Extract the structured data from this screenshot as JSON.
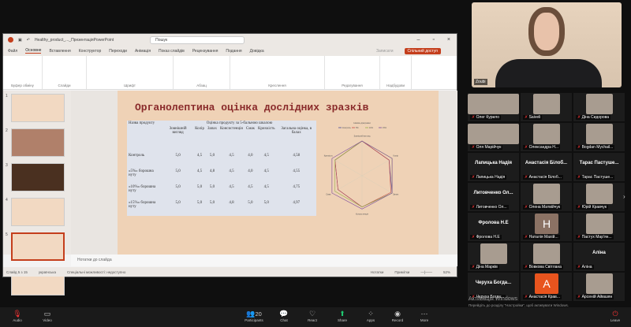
{
  "ppt": {
    "title": "Healthy_product_..._ПрезентаціяPowerPoint",
    "search": "Пошук",
    "tabs": [
      "Файл",
      "Основне",
      "Вставлення",
      "Конструктор",
      "Переходи",
      "Анімація",
      "Показ слайдів",
      "Рецензування",
      "Подання",
      "Довідка"
    ],
    "share": "Спільний доступ",
    "record": "Записати",
    "groups": [
      "Буфер обміну",
      "Слайди",
      "Шрифт",
      "Абзац",
      "Креслення",
      "Редагування",
      "Надбудови"
    ],
    "notes": "Нотатки до слайда",
    "status": {
      "slide": "Слайд 5 з 15",
      "lang": "українська",
      "access": "Спеціальні можливості: недоступно",
      "notes": "Нотатки",
      "comments": "Примітки",
      "zoom": "52%"
    },
    "thumb_numbers": [
      "1",
      "2",
      "3",
      "4",
      "5",
      "6"
    ]
  },
  "slide": {
    "title": "Органолептина оцінка дослідних зразків",
    "table": {
      "corner": "Назва продукту",
      "group": "Оцінка продукту за 5-бальною шкалою",
      "headers": [
        "Зовнішній вигляд",
        "Колір",
        "Запах",
        "Консистенція",
        "Смак",
        "Крихкість",
        "Загальна оцінка, в балах"
      ],
      "rows": [
        [
          "Контроль",
          "5,0",
          "4,5",
          "5,0",
          "4,5",
          "4,0",
          "4,5",
          "4,58"
        ],
        [
          "«5%» борошна нуту",
          "5,0",
          "4,5",
          "4,8",
          "4,5",
          "4,0",
          "4,5",
          "4,55"
        ],
        [
          "«10%» борошна нуту",
          "5,0",
          "5,0",
          "5,0",
          "4,5",
          "4,5",
          "4,5",
          "4,75"
        ],
        [
          "«15%» борошна нуту",
          "5,0",
          "5,0",
          "5,0",
          "4,8",
          "5,0",
          "5,0",
          "4,97"
        ]
      ]
    }
  },
  "chart_data": {
    "type": "radar",
    "title": "Назва діаграми",
    "categories": [
      "Зовнішній вигляд",
      "Колір",
      "Запах",
      "Консистенція",
      "Смак",
      "Крихкість"
    ],
    "range": [
      0,
      5
    ],
    "series": [
      {
        "name": "Контроль",
        "color": "#4a4a9a",
        "values": [
          5,
          4.5,
          5,
          4.5,
          4,
          4.5
        ]
      },
      {
        "name": "5%",
        "color": "#c24a4a",
        "values": [
          5,
          4.5,
          4.8,
          4.5,
          4,
          4.5
        ]
      },
      {
        "name": "10%",
        "color": "#9ab04a",
        "values": [
          5,
          5,
          5,
          4.5,
          4.5,
          4.5
        ]
      },
      {
        "name": "15%",
        "color": "#7a4a9a",
        "values": [
          5,
          5,
          5,
          4.8,
          5,
          5
        ]
      }
    ]
  },
  "speaker": {
    "name": "Zoubi"
  },
  "participants": [
    {
      "name": "Олег Курило",
      "t": "p"
    },
    {
      "name": "Saiveli",
      "t": "p"
    },
    {
      "name": "Діна Сидорова",
      "t": "p"
    },
    {
      "name": "Оля Марійчук",
      "t": "p"
    },
    {
      "name": "Олександра Н...",
      "t": "p"
    },
    {
      "name": "Bogdan Mychail...",
      "t": "p"
    },
    {
      "name": "Лапицька Надія",
      "big": "Лапицька Надія",
      "t": "n"
    },
    {
      "name": "Анастасія Білоб...",
      "big": "Анастасія Білоб...",
      "t": "n"
    },
    {
      "name": "Тарас Пастуше...",
      "big": "Тарас Пастуше...",
      "t": "n"
    },
    {
      "name": "Литовченко Ол...",
      "big": "Литовченко Ол...",
      "t": "n"
    },
    {
      "name": "Олена Матвійчук",
      "t": "p"
    },
    {
      "name": "Юрій Кравчук",
      "t": "p"
    },
    {
      "name": "Фролова Н.Е",
      "big": "Фролова Н.Е",
      "t": "n"
    },
    {
      "name": "Наталія Махій...",
      "t": "a",
      "letter": "H",
      "color": "#8b7264"
    },
    {
      "name": "Пастух Мар'ян...",
      "t": "p"
    },
    {
      "name": "Діна Марків",
      "t": "p"
    },
    {
      "name": "Вовкова Світлана",
      "t": "p"
    },
    {
      "name": "Аліна",
      "big": "Аліна",
      "t": "n"
    },
    {
      "name": "Черуха Богда...",
      "big": "Черуха Богда...",
      "t": "n"
    },
    {
      "name": "Анастасія Крав...",
      "t": "a",
      "letter": "A",
      "color": "#e8541e"
    },
    {
      "name": "Арсеній Айвазян",
      "t": "p"
    }
  ],
  "watermark": {
    "title": "Активація Windows",
    "text": "Перейдіть до розділу \"Настройки\", щоб активувати Windows."
  },
  "toolbar": {
    "audio": "Audio",
    "video": "Video",
    "participants": "Participants",
    "count": "20",
    "chat": "Chat",
    "react": "React",
    "share": "Share",
    "apps": "Apps",
    "record": "Record",
    "more": "More",
    "leave": "Leave"
  }
}
